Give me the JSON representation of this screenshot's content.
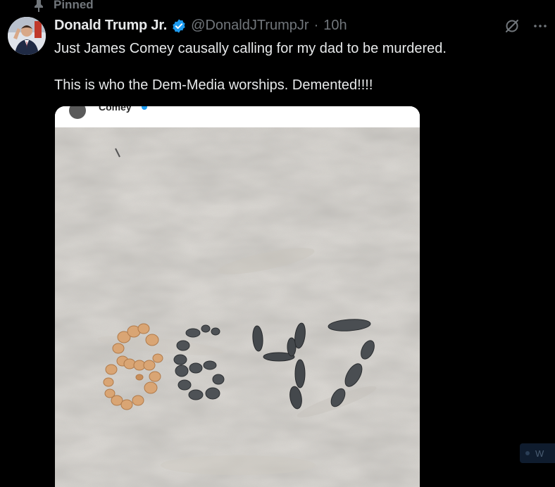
{
  "pinned": {
    "label": "Pinned",
    "icon": "pin-icon"
  },
  "tweet": {
    "author": {
      "display_name": "Donald Trump Jr.",
      "handle": "@DonaldJTrumpJr",
      "verified": true,
      "avatar": "avatar"
    },
    "separator": "·",
    "time": "10h",
    "text_lines": [
      "Just James Comey causally calling for my dad to be murdered.",
      "This is who the Dem-Media worships. Demented!!!!"
    ],
    "actions": {
      "grok_icon": "grok-icon",
      "more_icon": "more-icon"
    },
    "media": {
      "embedded_header_text": "Comey",
      "sand_number": "8647"
    }
  },
  "toast": {
    "text": "W"
  },
  "colors": {
    "background": "#000000",
    "text_primary": "#e7e9ea",
    "text_secondary": "#71767b",
    "verified_blue": "#1d9bf0",
    "sand": "#d9d6d1"
  }
}
